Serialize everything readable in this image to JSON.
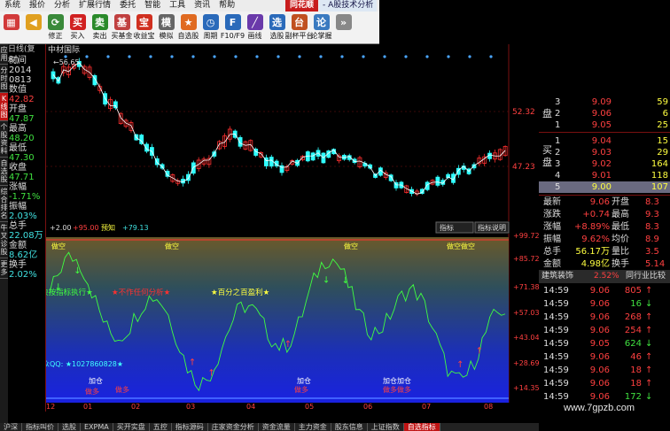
{
  "menu": [
    "系统",
    "报价",
    "分析",
    "扩展行情",
    "委托",
    "智能",
    "工具",
    "资讯",
    "帮助"
  ],
  "brand": "同花顺",
  "app_title": "- A股技术分析",
  "toolbar": [
    {
      "label": "",
      "icon": "grid-icon",
      "color": "#d23a3a"
    },
    {
      "label": "",
      "icon": "back-arrow-icon",
      "color": "#e0a020"
    },
    {
      "label": "修正",
      "icon": "refresh-icon",
      "color": "#3a8a3a"
    },
    {
      "label": "买入",
      "icon": "buy-icon",
      "color": "#d02020"
    },
    {
      "label": "卖出",
      "icon": "sell-icon",
      "color": "#2a8a2a"
    },
    {
      "label": "买基金",
      "icon": "fund-icon",
      "color": "#c04040"
    },
    {
      "label": "收益宝",
      "icon": "yield-icon",
      "color": "#d03020"
    },
    {
      "label": "模拟",
      "icon": "simulate-icon",
      "color": "#666"
    },
    {
      "label": "自选股",
      "icon": "favorite-icon",
      "color": "#e06a20"
    },
    {
      "label": "周期",
      "icon": "period-icon",
      "color": "#2a6aba"
    },
    {
      "label": "F10/F9",
      "icon": "f10-icon",
      "color": "#2a6aba"
    },
    {
      "label": "画线",
      "icon": "draw-line-icon",
      "color": "#6a3aaa"
    },
    {
      "label": "选股",
      "icon": "stock-select-icon",
      "color": "#2a6aba"
    },
    {
      "label": "副杯平台",
      "icon": "platform-icon",
      "color": "#c05020"
    },
    {
      "label": "论掌握",
      "icon": "forum-icon",
      "color": "#3a7ac0"
    },
    {
      "label": "",
      "icon": "more-icon",
      "color": "#888"
    }
  ],
  "left_tabs": [
    "应用",
    "分时图",
    "K线图",
    "个股资料",
    "自选股",
    "综合排名",
    "牛叉诊股",
    "更多"
  ],
  "info": {
    "header": "日线(复权)",
    "rows": [
      {
        "text": "时间",
        "color": "#dddddd"
      },
      {
        "text": "2014",
        "color": "#dddddd"
      },
      {
        "text": "0813",
        "color": "#dddddd"
      },
      {
        "text": "数值",
        "color": "#dddddd"
      },
      {
        "text": "42.82",
        "color": "#ff4040"
      },
      {
        "text": "开盘",
        "color": "#dddddd"
      },
      {
        "text": "47.87",
        "color": "#40e040"
      },
      {
        "text": "最高",
        "color": "#dddddd"
      },
      {
        "text": "48.20",
        "color": "#40e040"
      },
      {
        "text": "最低",
        "color": "#dddddd"
      },
      {
        "text": "47.30",
        "color": "#40e040"
      },
      {
        "text": "收盘",
        "color": "#dddddd"
      },
      {
        "text": "47.71",
        "color": "#40e040"
      },
      {
        "text": "涨幅",
        "color": "#dddddd"
      },
      {
        "text": "-1.71%",
        "color": "#40e040"
      },
      {
        "text": "振幅",
        "color": "#dddddd"
      },
      {
        "text": "2.03%",
        "color": "#40e0e0"
      },
      {
        "text": "总手",
        "color": "#dddddd"
      },
      {
        "text": "22.08万",
        "color": "#40e0e0"
      },
      {
        "text": "金额",
        "color": "#dddddd"
      },
      {
        "text": "8.62亿",
        "color": "#40e0e0"
      },
      {
        "text": "换手",
        "color": "#dddddd"
      },
      {
        "text": "2.02%",
        "color": "#40e0e0"
      }
    ]
  },
  "chart": {
    "stock_title": "中材国际",
    "price_labels": [
      "52.32",
      "47.23"
    ],
    "high_label": "56.65",
    "indicator_header": {
      "val": "+2.00",
      "a": "+95.00",
      "b": "预知",
      "c": "+79.13"
    },
    "indicator_tabs": [
      "指标",
      "指标说明"
    ],
    "osc_labels": [
      "+99.72",
      "+85.72",
      "+71.38",
      "+57.03",
      "+43.04",
      "+28.69",
      "+14.35"
    ],
    "annotations": [
      {
        "text": "★坚决按指标执行★",
        "color": "#40ff40"
      },
      {
        "text": "★不作任何分析★",
        "color": "#ff3030"
      },
      {
        "text": "★百分之百盈利★",
        "color": "#ffff40"
      },
      {
        "text": "指标适用众QQ: ★1027860828★",
        "color": "#40ffff"
      }
    ],
    "signal_labels": {
      "top": "做空",
      "bottom": "做多",
      "add": "加仓",
      "add2": "加仓加仓",
      "bottom2": "做多做多"
    },
    "x_labels": [
      "11",
      "12",
      "01",
      "02",
      "03",
      "04",
      "05",
      "06",
      "07",
      "08"
    ],
    "colors": {
      "up": "#ff3030",
      "down": "#30ffff",
      "ma": "#ffffff",
      "osc": "#40ff40"
    }
  },
  "chart_data": {
    "type": "candlestick",
    "title": "中材国际",
    "y_ticks": [
      52.32,
      47.23
    ],
    "high_marker": 56.65,
    "indicator_ticks": [
      99.72,
      85.72,
      71.38,
      57.03,
      43.04,
      28.69,
      14.35
    ],
    "x_labels": [
      "11",
      "12",
      "01",
      "02",
      "03",
      "04",
      "05",
      "06",
      "07",
      "08"
    ]
  },
  "quote": {
    "ask": [
      {
        "level": "3",
        "price": "9.09",
        "vol": "59"
      },
      {
        "level": "2",
        "price": "9.06",
        "vol": "6"
      },
      {
        "level": "1",
        "price": "9.05",
        "vol": "25"
      }
    ],
    "bid": [
      {
        "level": "1",
        "price": "9.04",
        "vol": "15"
      },
      {
        "level": "2",
        "price": "9.03",
        "vol": "29"
      },
      {
        "level": "3",
        "price": "9.02",
        "vol": "164"
      },
      {
        "level": "4",
        "price": "9.01",
        "vol": "118"
      },
      {
        "level": "5",
        "price": "9.00",
        "vol": "107"
      }
    ],
    "ask_label": "盘",
    "bid_label": "买盘",
    "stats": [
      {
        "l1": "最新",
        "v1": "9.06",
        "l2": "开盘",
        "v2": "8.3"
      },
      {
        "l1": "涨跌",
        "v1": "+0.74",
        "l2": "最高",
        "v2": "9.3"
      },
      {
        "l1": "涨幅",
        "v1": "+8.89%",
        "l2": "最低",
        "v2": "8.3"
      },
      {
        "l1": "振幅",
        "v1": "9.62%",
        "l2": "均价",
        "v2": "8.9"
      },
      {
        "l1": "总手",
        "v1": "56.17万",
        "l2": "量比",
        "v2": "3.5"
      },
      {
        "l1": "金额",
        "v1": "4.98亿",
        "l2": "换手",
        "v2": "5.14"
      }
    ],
    "sector": "建筑装饰",
    "sector_change": "2.52%",
    "sector_link": "同行业比较",
    "ticks": [
      {
        "t": "14:59",
        "p": "9.06",
        "v": "805",
        "d": "up"
      },
      {
        "t": "14:59",
        "p": "9.06",
        "v": "16",
        "d": "down"
      },
      {
        "t": "14:59",
        "p": "9.06",
        "v": "268",
        "d": "up"
      },
      {
        "t": "14:59",
        "p": "9.06",
        "v": "254",
        "d": "up"
      },
      {
        "t": "14:59",
        "p": "9.05",
        "v": "624",
        "d": "down"
      },
      {
        "t": "14:59",
        "p": "9.06",
        "v": "46",
        "d": "up"
      },
      {
        "t": "14:59",
        "p": "9.06",
        "v": "18",
        "d": "up"
      },
      {
        "t": "14:59",
        "p": "9.06",
        "v": "18",
        "d": "up"
      },
      {
        "t": "14:59",
        "p": "9.06",
        "v": "172",
        "d": "down"
      }
    ]
  },
  "bottom_tabs": [
    "沪深",
    "指标叫价",
    "选股",
    "EXPMA",
    "买开实盘",
    "五控",
    "指标源码",
    "庄家资金分析",
    "资金流量",
    "主力资金",
    "股东信息",
    "上证指数",
    "自选指标"
  ],
  "watermark": "www.7gpzb.com"
}
